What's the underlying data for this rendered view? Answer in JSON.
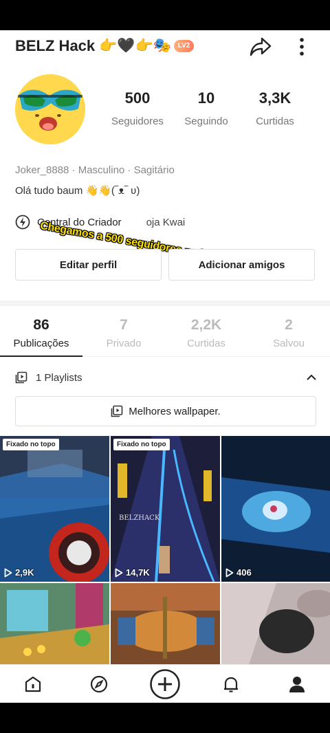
{
  "header": {
    "username": "BELZ Hack",
    "emojis": "👉🖤👉🎭",
    "level_badge": "LV2",
    "share_icon": "share-arrow-icon",
    "more_icon": "more-vertical-icon"
  },
  "profile": {
    "stats": [
      {
        "value": "500",
        "label": "Seguidores"
      },
      {
        "value": "10",
        "label": "Seguindo"
      },
      {
        "value": "3,3K",
        "label": "Curtidas"
      }
    ],
    "meta": "Joker_8888 · Masculino · Sagitário",
    "bio": "Olá tudo baum 👋👋(‾ᴥ‾ ʋ)",
    "creator_center": "Central do Criador",
    "kwai_link": "oja Kwai",
    "overlay_caption": "Chegamos a 500 seguidores muito obrigado"
  },
  "actions": {
    "edit_profile": "Editar perfil",
    "add_friends": "Adicionar amigos"
  },
  "tabs": [
    {
      "count": "86",
      "label": "Publicações",
      "active": true
    },
    {
      "count": "7",
      "label": "Privado",
      "active": false
    },
    {
      "count": "2,2K",
      "label": "Curtidas",
      "active": false
    },
    {
      "count": "2",
      "label": "Salvou",
      "active": false
    }
  ],
  "playlists": {
    "summary": "1 Playlists",
    "item": "Melhores wallpaper."
  },
  "videos": [
    {
      "pinned": "Fixado no topo",
      "views": "2,9K"
    },
    {
      "pinned": "Fixado no topo",
      "views": "14,7K",
      "watermark": "BELZHACK"
    },
    {
      "pinned": "",
      "views": "406"
    },
    {
      "pinned": "",
      "views": ""
    },
    {
      "pinned": "",
      "views": ""
    },
    {
      "pinned": "",
      "views": ""
    }
  ],
  "nav": [
    "home-icon",
    "discover-icon",
    "create-icon",
    "notifications-icon",
    "profile-icon"
  ],
  "colors": {
    "accent": "#ff7a5a",
    "overlay_text": "#ffe100",
    "avatar_bg": "#ffd84d"
  }
}
